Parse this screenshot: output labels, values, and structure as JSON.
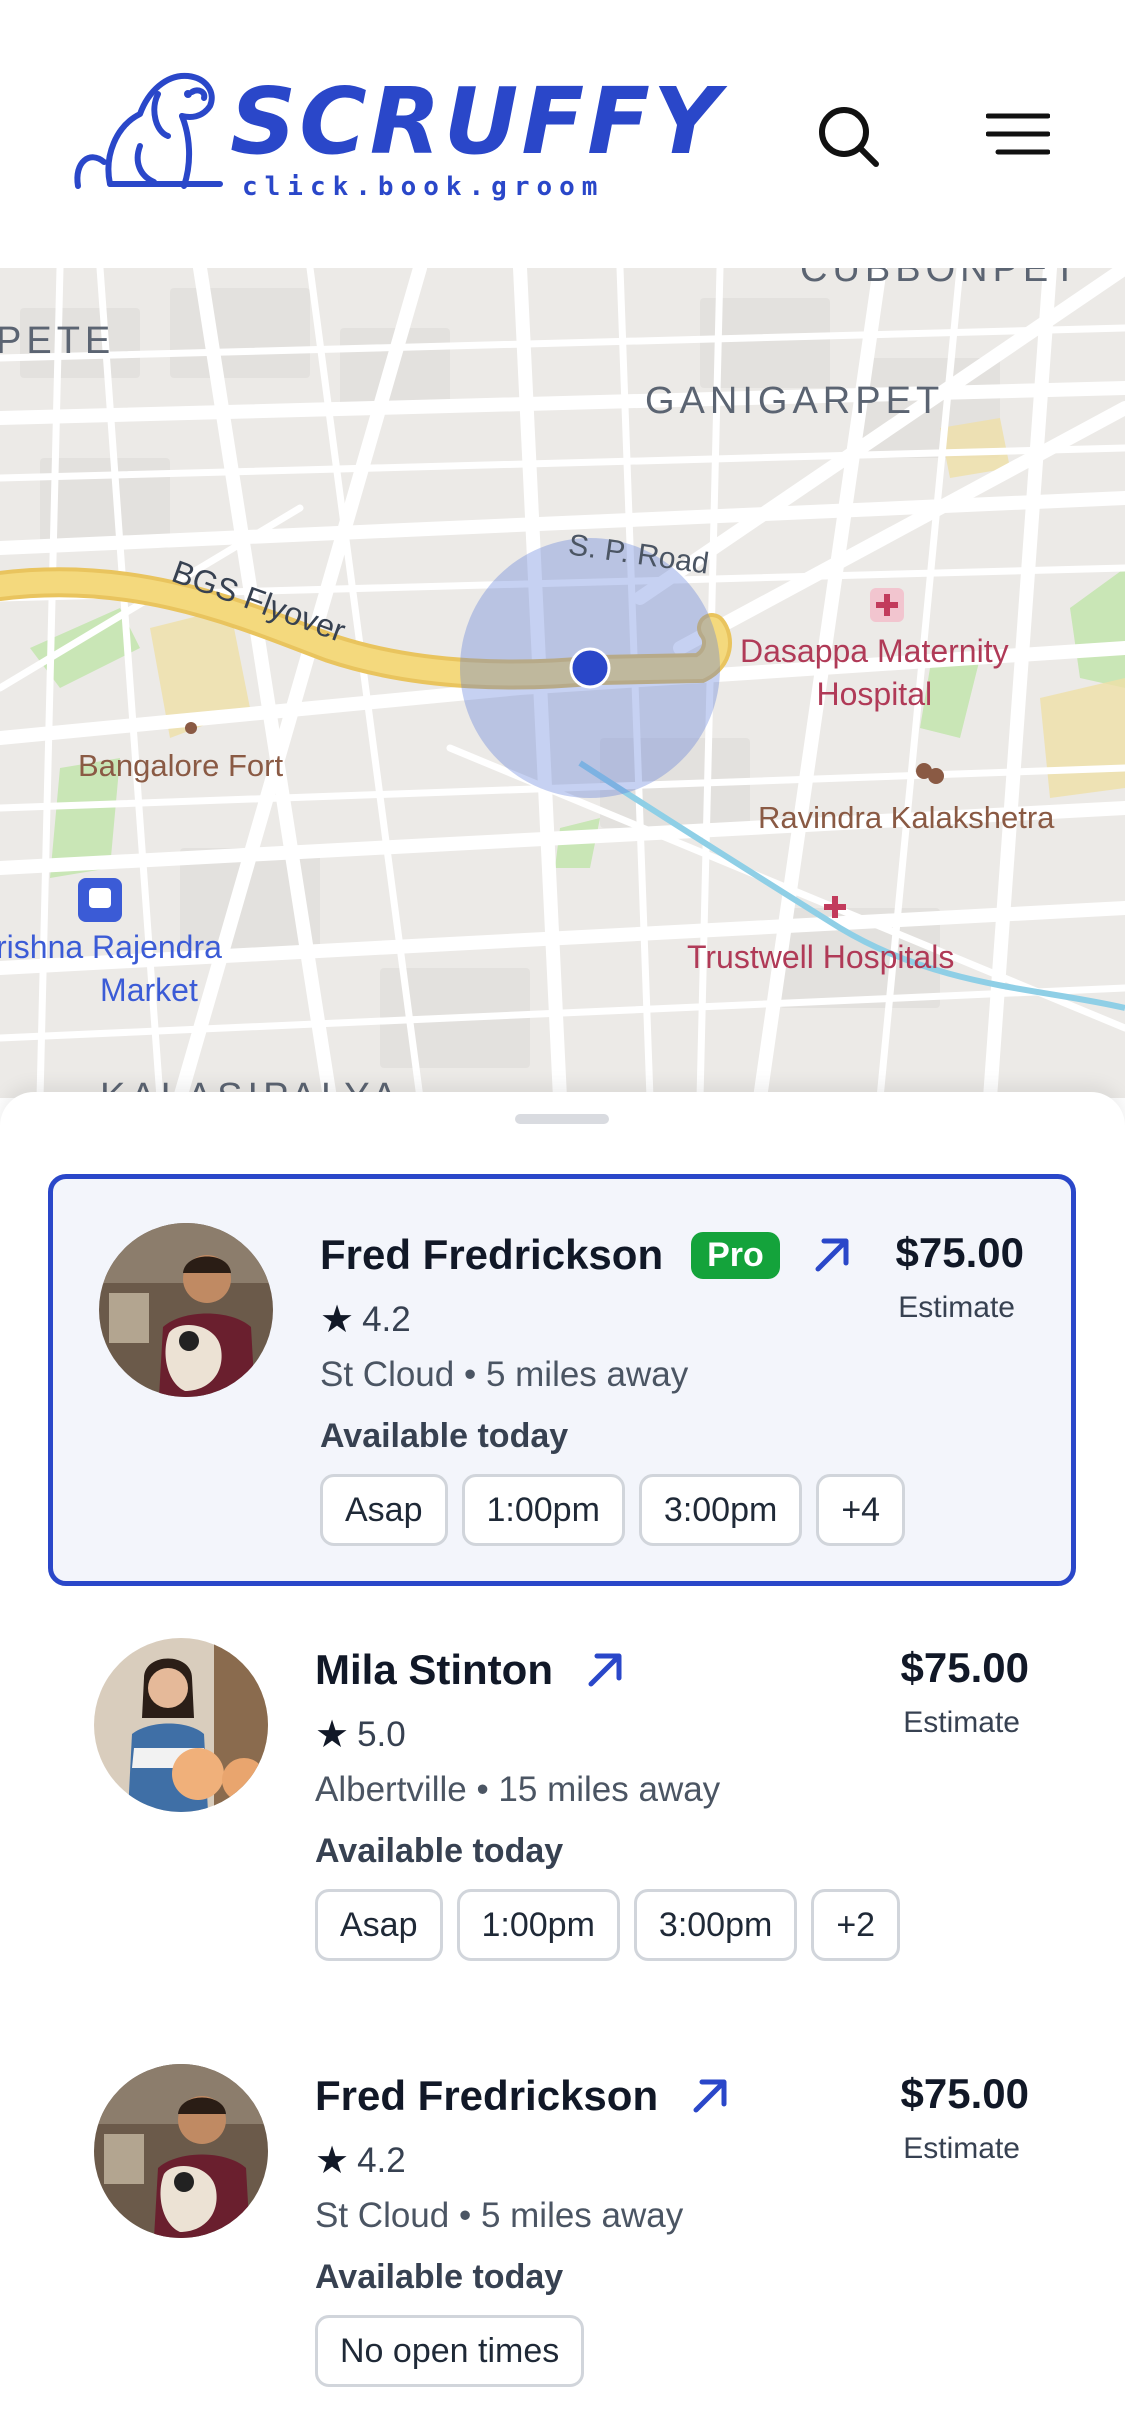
{
  "header": {
    "logo_text": "SCRUFFY",
    "logo_tagline": "click.book.groom",
    "search_icon": "search-icon",
    "menu_icon": "menu-icon"
  },
  "map": {
    "labels": {
      "ganigarpet": "GANIGARPET",
      "pete": "PETE",
      "cubbonpet": "CUBBONPET",
      "kalasipalya": "KALASIPALYA",
      "sp_road": "S. P. Road",
      "bgs_flyover": "BGS Flyover",
      "bangalore_fort": "Bangalore Fort",
      "krishna_market_1": "rishna Rajendra",
      "krishna_market_2": "Market",
      "dasappa_1": "Dasappa Maternity",
      "dasappa_2": "Hospital",
      "ravindra": "Ravindra Kalakshetra",
      "trustwell": "Trustwell Hospitals"
    },
    "colors": {
      "water": "#8fcfe6",
      "road": "#ffffff",
      "flyover": "#f2d36b",
      "park": "#c9e6b6",
      "location": "#2a47c9"
    }
  },
  "groomers": [
    {
      "name": "Fred Fredrickson",
      "badge": "Pro",
      "rating": "4.2",
      "location": "St Cloud • 5 miles away",
      "price": "$75.00",
      "price_note": "Estimate",
      "availability_label": "Available today",
      "slots": [
        "Asap",
        "1:00pm",
        "3:00pm",
        "+4"
      ],
      "selected": true
    },
    {
      "name": "Mila Stinton",
      "rating": "5.0",
      "location": "Albertville • 15 miles away",
      "price": "$75.00",
      "price_note": "Estimate",
      "availability_label": "Available today",
      "slots": [
        "Asap",
        "1:00pm",
        "3:00pm",
        "+2"
      ]
    },
    {
      "name": "Fred Fredrickson",
      "rating": "4.2",
      "location": "St Cloud • 5 miles away",
      "price": "$75.00",
      "price_note": "Estimate",
      "availability_label": "Available today",
      "slots": [
        "No open times"
      ]
    }
  ],
  "colors": {
    "accent": "#2a47c9",
    "pro_badge": "#14a33b"
  }
}
